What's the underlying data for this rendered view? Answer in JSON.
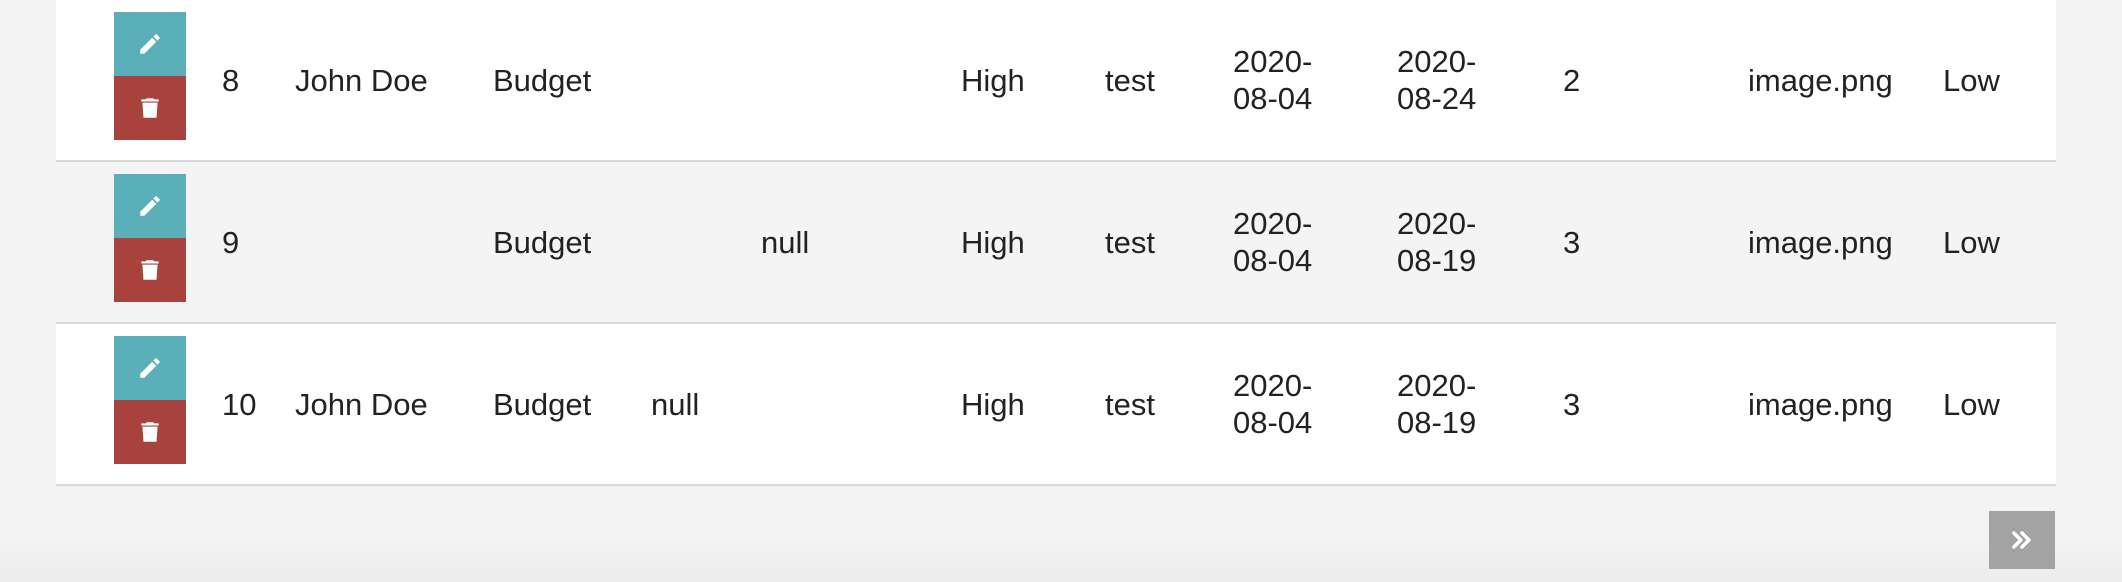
{
  "colors": {
    "edit_button": "#5aafb8",
    "delete_button": "#a8423c",
    "pager_button": "#a3a3a3",
    "row_odd": "#ffffff",
    "row_even": "#f4f4f4"
  },
  "icons": {
    "edit": "pencil-icon",
    "delete": "trash-icon",
    "next_page": "double-chevron-right-icon"
  },
  "rows": [
    {
      "id": "8",
      "name": "John Doe",
      "category": "Budget",
      "field_a": "",
      "field_b": "",
      "priority": "High",
      "note": "test",
      "start_date": "2020-08-04",
      "end_date": "2020-08-24",
      "count": "2",
      "file": "image.png",
      "level": "Low"
    },
    {
      "id": "9",
      "name": "",
      "category": "Budget",
      "field_a": "",
      "field_b": "null",
      "priority": "High",
      "note": "test",
      "start_date": "2020-08-04",
      "end_date": "2020-08-19",
      "count": "3",
      "file": "image.png",
      "level": "Low"
    },
    {
      "id": "10",
      "name": "John Doe",
      "category": "Budget",
      "field_a": "null",
      "field_b": "",
      "priority": "High",
      "note": "test",
      "start_date": "2020-08-04",
      "end_date": "2020-08-19",
      "count": "3",
      "file": "image.png",
      "level": "Low"
    }
  ]
}
